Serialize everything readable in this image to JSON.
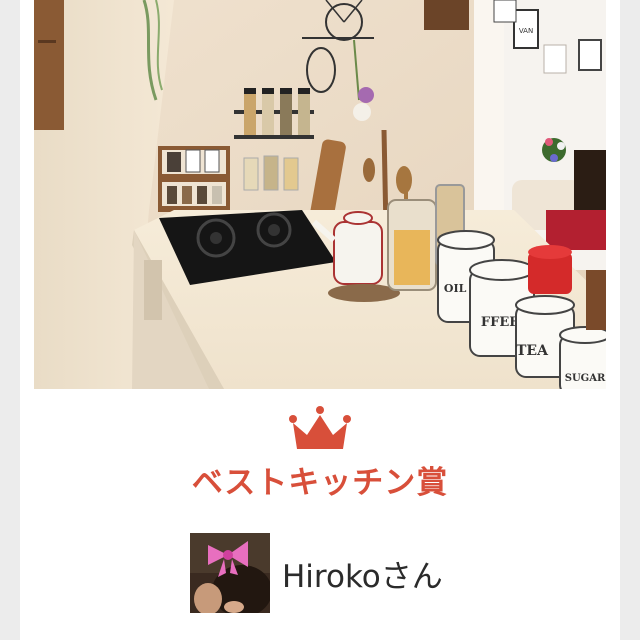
{
  "award": {
    "title": "ベストキッチン賞",
    "accent_color": "#d84f3a",
    "icon": "crown-icon"
  },
  "user": {
    "name": "Hirokoさん",
    "avatar_icon": "avatar"
  },
  "photo": {
    "canister_labels": [
      "OIL PO",
      "FFEE",
      "TEA",
      "SUGAR"
    ],
    "sign_text": "VAN"
  }
}
